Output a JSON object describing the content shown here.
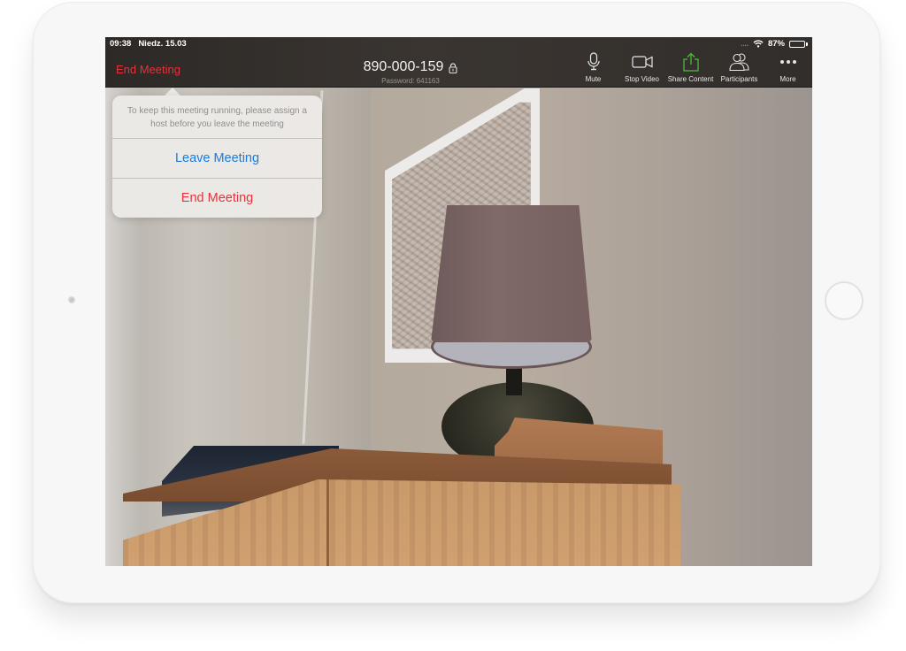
{
  "status_bar": {
    "time": "09:38",
    "date": "Niedz. 15.03",
    "signal": "....",
    "battery_percent_label": "87%",
    "battery_level": 0.87
  },
  "header": {
    "end_meeting_label": "End Meeting",
    "meeting_id": "890-000-159",
    "password_label": "Password: 641163"
  },
  "toolbar": {
    "items": [
      {
        "icon": "microphone-icon",
        "label": "Mute"
      },
      {
        "icon": "video-camera-icon",
        "label": "Stop Video"
      },
      {
        "icon": "share-upload-icon",
        "label": "Share Content"
      },
      {
        "icon": "participants-icon",
        "label": "Participants"
      },
      {
        "icon": "more-dots-icon",
        "label": "More"
      }
    ]
  },
  "popover": {
    "message": "To keep this meeting running, please assign a host before you leave the meeting",
    "leave_label": "Leave Meeting",
    "end_label": "End Meeting"
  },
  "colors": {
    "end_red": "#e2333b",
    "leave_blue": "#1a7be0",
    "share_green": "#4dbb38",
    "toolbar_bg": "#35302d"
  }
}
